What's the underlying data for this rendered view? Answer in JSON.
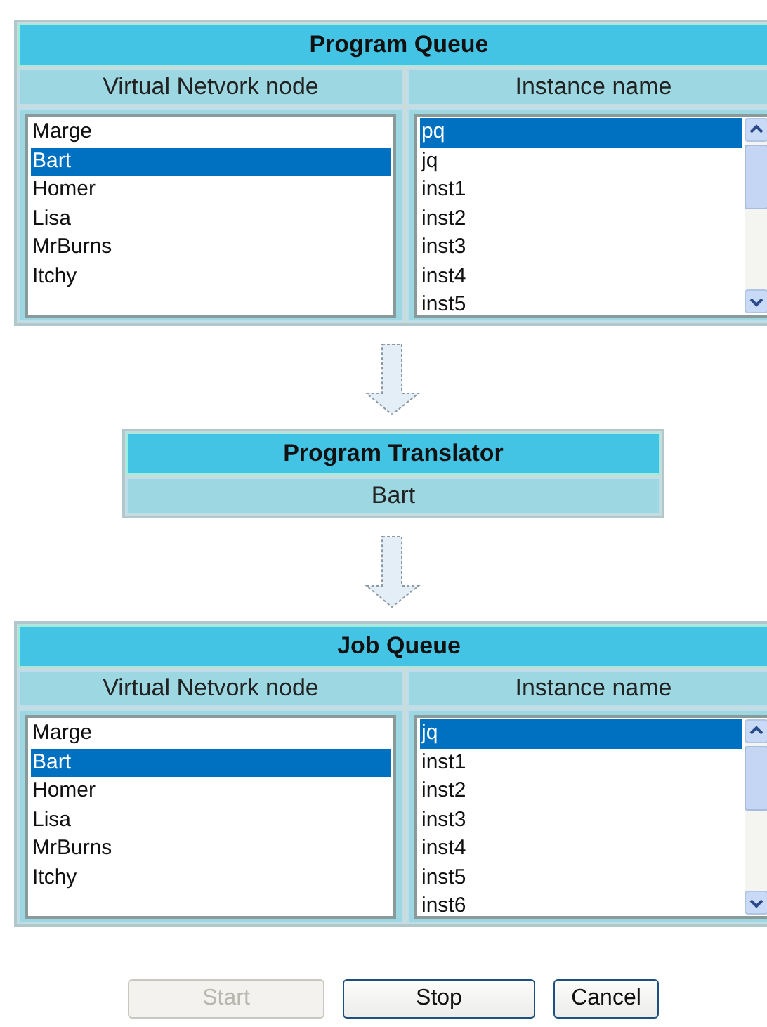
{
  "program_queue": {
    "title": "Program Queue",
    "columns": [
      "Virtual Netvork node",
      "Instance name"
    ],
    "nodes": [
      {
        "label": "Marge",
        "selected": false
      },
      {
        "label": "Bart",
        "selected": true
      },
      {
        "label": "Homer",
        "selected": false
      },
      {
        "label": "Lisa",
        "selected": false
      },
      {
        "label": "MrBurns",
        "selected": false
      },
      {
        "label": "Itchy",
        "selected": false
      }
    ],
    "instances": [
      {
        "label": "pq",
        "selected": true
      },
      {
        "label": "jq",
        "selected": false
      },
      {
        "label": "inst1",
        "selected": false
      },
      {
        "label": "inst2",
        "selected": false
      },
      {
        "label": "inst3",
        "selected": false
      },
      {
        "label": "inst4",
        "selected": false
      },
      {
        "label": "inst5",
        "selected": false
      }
    ]
  },
  "program_translator": {
    "title": "Program Translator",
    "value": "Bart"
  },
  "job_queue": {
    "title": "Job Queue",
    "columns": [
      "Virtual Netvork node",
      "Instance name"
    ],
    "nodes": [
      {
        "label": "Marge",
        "selected": false
      },
      {
        "label": "Bart",
        "selected": true
      },
      {
        "label": "Homer",
        "selected": false
      },
      {
        "label": "Lisa",
        "selected": false
      },
      {
        "label": "MrBurns",
        "selected": false
      },
      {
        "label": "Itchy",
        "selected": false
      }
    ],
    "instances": [
      {
        "label": "jq",
        "selected": true
      },
      {
        "label": "inst1",
        "selected": false
      },
      {
        "label": "inst2",
        "selected": false
      },
      {
        "label": "inst3",
        "selected": false
      },
      {
        "label": "inst4",
        "selected": false
      },
      {
        "label": "inst5",
        "selected": false
      },
      {
        "label": "inst6",
        "selected": false
      }
    ]
  },
  "buttons": [
    {
      "label": "Start",
      "disabled": true
    },
    {
      "label": "Stop",
      "disabled": false
    },
    {
      "label": "Cancel",
      "disabled": false
    }
  ]
}
